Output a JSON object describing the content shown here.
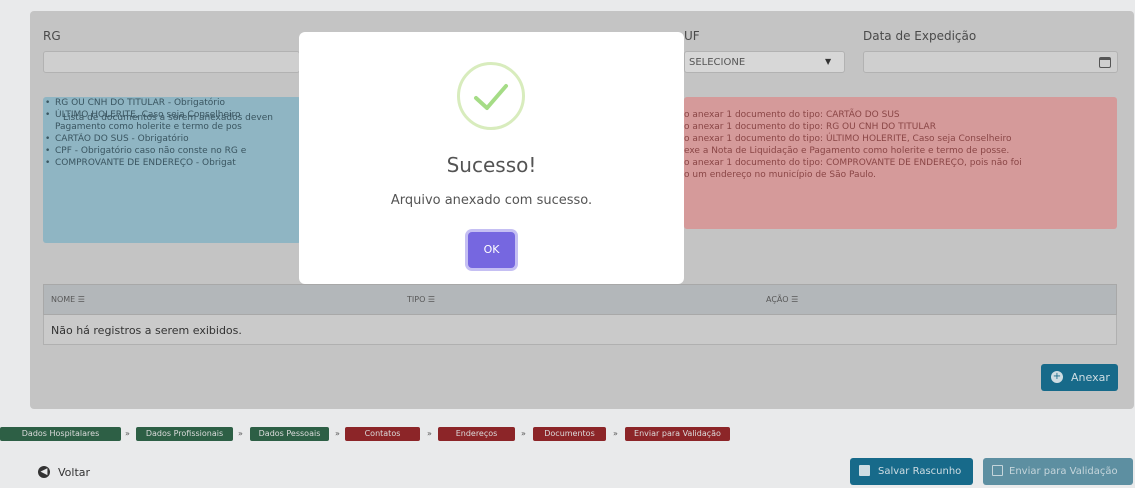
{
  "form": {
    "rg_label": "RG",
    "uf_label": "UF",
    "uf_selected": "SELECIONE",
    "data_exp_label": "Data de Expedição",
    "data_exp_value": ""
  },
  "info_alert": {
    "intro": "Lista de documentos a serem anexados deven",
    "items": [
      "RG OU CNH DO TITULAR - Obrigatório",
      "ÚLTIMO HOLERITE, Caso seja Conselheiro Pagamento como holerite e termo de pos",
      "CARTÃO DO SUS - Obrigatório",
      "CPF - Obrigatório caso não conste no RG e",
      "COMPROVANTE DE ENDEREÇO - Obrigat"
    ]
  },
  "danger_alert": {
    "lines": [
      "o anexar 1 documento do tipo: CARTÃO DO SUS",
      "o anexar 1 documento do tipo: RG OU CNH DO TITULAR",
      "o anexar 1 documento do tipo: ÚLTIMO HOLERITE, Caso seja Conselheiro",
      "exe a Nota de Liquidação e Pagamento como holerite e termo de posse.",
      "o anexar 1 documento do tipo: COMPROVANTE DE ENDEREÇO, pois não foi",
      "o um endereço no município de São Paulo."
    ]
  },
  "table": {
    "headers": [
      "NOME",
      "TIPO",
      "AÇÃO"
    ],
    "empty_message": "Não há registros a serem exibidos."
  },
  "buttons": {
    "anexar": "Anexar",
    "voltar": "Voltar",
    "salvar": "Salvar Rascunho",
    "enviar": "Enviar para Validação"
  },
  "steps": [
    {
      "label": "Dados Hospitalares",
      "status": "done"
    },
    {
      "label": "Dados Profissionais",
      "status": "done"
    },
    {
      "label": "Dados Pessoais",
      "status": "done"
    },
    {
      "label": "Contatos",
      "status": "pending"
    },
    {
      "label": "Endereços",
      "status": "pending"
    },
    {
      "label": "Documentos",
      "status": "pending"
    },
    {
      "label": "Enviar para Validação",
      "status": "pending"
    }
  ],
  "modal": {
    "title": "Sucesso!",
    "message": "Arquivo anexado com sucesso.",
    "ok": "OK",
    "icon": "checkmark-icon"
  },
  "colors": {
    "success_green": "#a5dc86",
    "confirm_purple": "#7667e0",
    "primary_blue": "#176a8a",
    "step_green": "#2d5f45",
    "step_red": "#8c2528"
  }
}
